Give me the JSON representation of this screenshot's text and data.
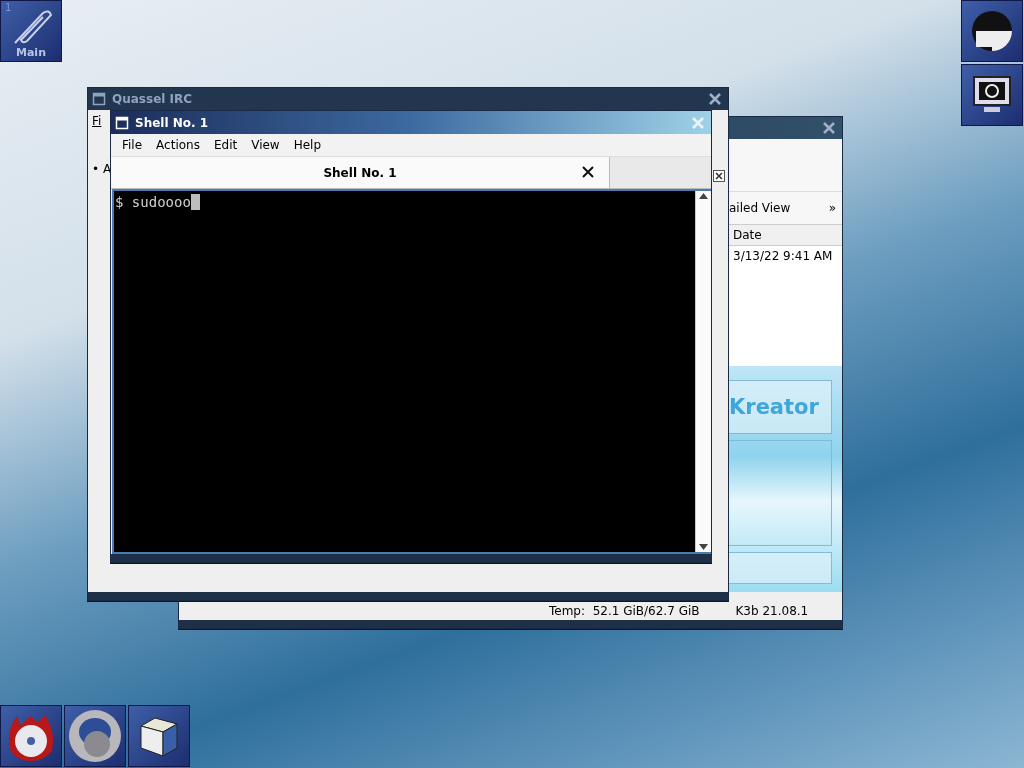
{
  "pager": {
    "number": "1",
    "label": "Main"
  },
  "back_window": {
    "view_label": "ailed View",
    "more": "»",
    "columns": [
      "Date"
    ],
    "rows": [
      "3/13/22 9:41 AM"
    ],
    "banner": "Kreator",
    "status": [
      "Temp:  52.1 GiB/62.7 GiB",
      "K3b 21.08.1"
    ]
  },
  "quassel": {
    "title": "Quassel IRC",
    "menu_fragment": "Fi",
    "list_fragment": "• A"
  },
  "shell": {
    "title": "Shell No. 1",
    "menu": [
      "File",
      "Actions",
      "Edit",
      "View",
      "Help"
    ],
    "tabs": [
      {
        "label": "Shell No. 1",
        "selected": true
      }
    ],
    "terminal": "$ sudoooo"
  }
}
